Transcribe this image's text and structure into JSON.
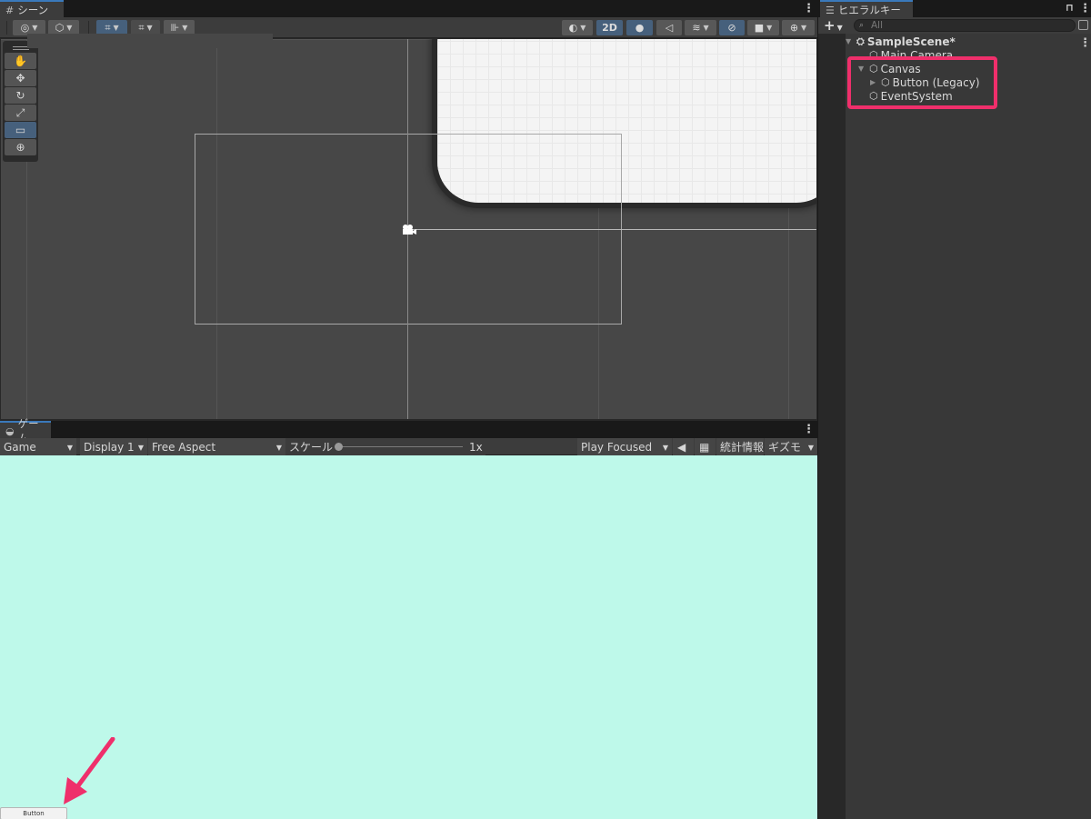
{
  "scene": {
    "tab_label": "シーン",
    "tab_icon": "grid-icon",
    "btn_2d": "2D"
  },
  "game": {
    "tab_label": "ゲーム",
    "tab_icon": "gamepad-icon",
    "view_mode": "Game",
    "display": "Display 1",
    "aspect": "Free Aspect",
    "scale_label": "スケール",
    "scale_value": "1x",
    "play_mode": "Play Focused",
    "stats": "統計情報",
    "gizmos": "ギズモ",
    "button_label": "Button",
    "background_color": "#bef9ea"
  },
  "hierarchy": {
    "tab_label": "ヒエラルキー",
    "search_placeholder": "All",
    "scene_name": "SampleScene*",
    "items": [
      {
        "label": "Main Camera"
      },
      {
        "label": "Canvas"
      },
      {
        "label": "Button (Legacy)"
      },
      {
        "label": "EventSystem"
      }
    ]
  },
  "colors": {
    "accent": "#3a79bb",
    "highlight": "#ef2f6b"
  }
}
